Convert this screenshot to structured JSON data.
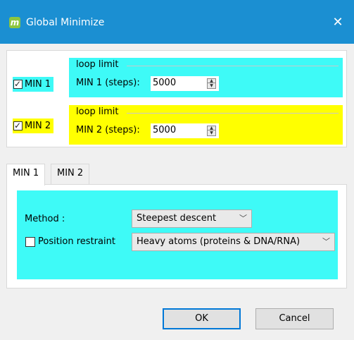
{
  "window": {
    "title": "Global Minimize",
    "app_icon_letter": "m",
    "close_glyph": "✕"
  },
  "min1": {
    "checkbox_label": "MIN 1",
    "checked": true,
    "group_title": "loop limit",
    "steps_label": "MIN 1 (steps):",
    "steps_value": "5000",
    "color": "#3efaf7"
  },
  "min2": {
    "checkbox_label": "MIN 2",
    "checked": true,
    "group_title": "loop limit",
    "steps_label": "MIN 2 (steps):",
    "steps_value": "5000",
    "color": "#ffff00"
  },
  "tabs": [
    {
      "label": "MIN 1",
      "active": true
    },
    {
      "label": "MIN 2",
      "active": false
    }
  ],
  "panel": {
    "method_label": "Method :",
    "method_value": "Steepest descent",
    "position_restraint_label": "Position restraint",
    "position_restraint_checked": false,
    "restraint_value": "Heavy atoms (proteins & DNA/RNA)"
  },
  "buttons": {
    "ok": "OK",
    "cancel": "Cancel"
  },
  "colors": {
    "titlebar": "#1b8fd2",
    "cyan": "#3efaf7",
    "yellow": "#ffff00",
    "focus": "#0078d7"
  }
}
